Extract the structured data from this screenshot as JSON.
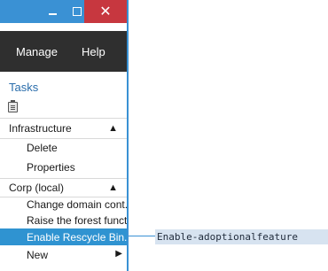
{
  "titlebar": {
    "minimize": "minimize",
    "maximize": "maximize",
    "close": "✕"
  },
  "menu": {
    "manage": "Manage",
    "help": "Help"
  },
  "tasks": {
    "title": "Tasks",
    "icon": "clipboard-icon"
  },
  "groups": [
    {
      "label": "Infrastructure",
      "items": [
        "Delete",
        "Properties"
      ]
    },
    {
      "label": "Corp (local)",
      "items": [
        "Change domain cont...",
        "Raise the forest funct...",
        "Enable Rescycle Bin...",
        "New"
      ]
    }
  ],
  "callout": {
    "text": "Enable-adoptionalfeature"
  },
  "colors": {
    "accent": "#3a91d4",
    "close": "#c7373f",
    "menubar": "#2f2f2f",
    "selected": "#2f93d1",
    "callout_bg": "#d7e3f0"
  }
}
